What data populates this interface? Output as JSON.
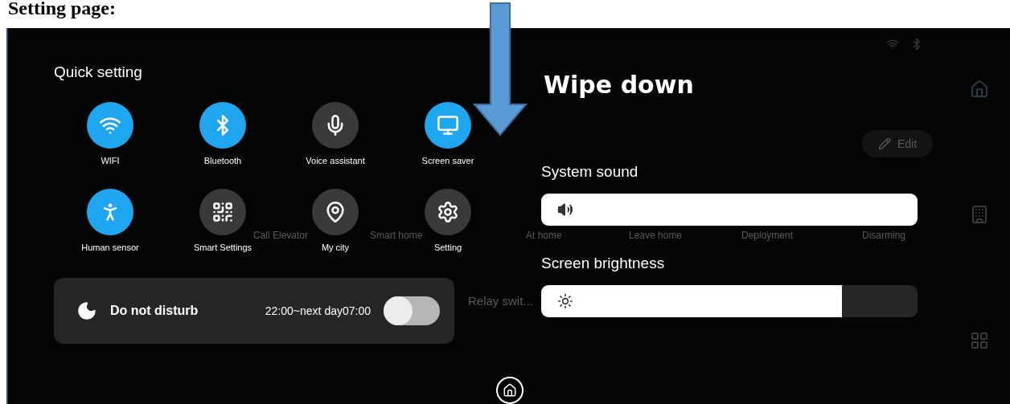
{
  "heading": "Setting page:",
  "annotation": {
    "text": "Wipe down"
  },
  "panel": {
    "title": "Quick setting",
    "tiles": [
      {
        "label": "WIFI",
        "kind": "wifi",
        "on": true
      },
      {
        "label": "Bluetooth",
        "kind": "bluetooth",
        "on": true
      },
      {
        "label": "Voice assistant",
        "kind": "voice",
        "on": false
      },
      {
        "label": "Screen saver",
        "kind": "screensaver",
        "on": true
      },
      {
        "label": "Human sensor",
        "kind": "sensor",
        "on": true
      },
      {
        "label": "Smart Settings",
        "kind": "smart",
        "on": false
      },
      {
        "label": "My city",
        "kind": "city",
        "on": false
      },
      {
        "label": "Setting",
        "kind": "setting",
        "on": false
      }
    ],
    "dnd": {
      "label": "Do not disturb",
      "schedule": "22:00~next day07:00",
      "on": false
    }
  },
  "sliders": [
    {
      "label": "System sound",
      "kind": "sound",
      "level": 1
    },
    {
      "label": "Screen brightness",
      "kind": "brightness",
      "level": 0.8
    }
  ],
  "background": {
    "scenes": [
      "Call Elevator",
      "Smart home",
      "At home",
      "Leave home",
      "Deployment",
      "Disarming"
    ],
    "relay": "Relay swit...",
    "edit_button": "Edit"
  }
}
